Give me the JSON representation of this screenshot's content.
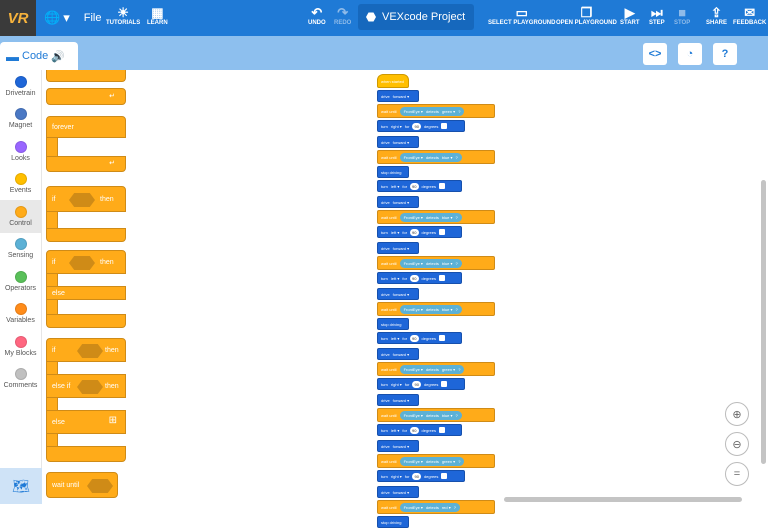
{
  "topbar": {
    "logo": "VR",
    "file": "File",
    "tutorials": "TUTORIALS",
    "learn": "LEARN",
    "undo": "UNDO",
    "redo": "REDO",
    "project": "VEXcode Project",
    "select_playground": "SELECT PLAYGROUND",
    "open_playground": "OPEN PLAYGROUND",
    "start": "START",
    "step": "STEP",
    "stop": "STOP",
    "share": "SHARE",
    "feedback": "FEEDBACK"
  },
  "code_tab": "Code",
  "categories": [
    {
      "label": "Drivetrain",
      "color": "#1e66d8"
    },
    {
      "label": "Magnet",
      "color": "#4a78c4"
    },
    {
      "label": "Looks",
      "color": "#9966ff"
    },
    {
      "label": "Events",
      "color": "#ffbf00"
    },
    {
      "label": "Control",
      "color": "#ffab19"
    },
    {
      "label": "Sensing",
      "color": "#5cb1d6"
    },
    {
      "label": "Operators",
      "color": "#59c059"
    },
    {
      "label": "Variables",
      "color": "#ff8c1a"
    },
    {
      "label": "My Blocks",
      "color": "#ff6680"
    },
    {
      "label": "Comments",
      "color": "#c0c0c0"
    }
  ],
  "palette": {
    "forever": "forever",
    "if": "if",
    "then": "then",
    "else": "else",
    "else_if": "else if",
    "wait_until": "wait until"
  },
  "script": [
    {
      "type": "hat",
      "text": "when started"
    },
    {
      "type": "drive",
      "text": "drive",
      "dir": "forward"
    },
    {
      "type": "wait",
      "sensor": "FrontEye",
      "color": "green"
    },
    {
      "type": "turn",
      "dir": "right",
      "deg": "90"
    },
    {
      "type": "drive",
      "text": "drive",
      "dir": "forward"
    },
    {
      "type": "wait",
      "sensor": "FrontEye",
      "color": "blue"
    },
    {
      "type": "stop",
      "text": "stop driving"
    },
    {
      "type": "turn",
      "dir": "left",
      "deg": "90"
    },
    {
      "type": "drive",
      "text": "drive",
      "dir": "forward"
    },
    {
      "type": "wait",
      "sensor": "FrontEye",
      "color": "blue"
    },
    {
      "type": "turn",
      "dir": "left",
      "deg": "90"
    },
    {
      "type": "drive",
      "text": "drive",
      "dir": "forward"
    },
    {
      "type": "wait",
      "sensor": "FrontEye",
      "color": "blue"
    },
    {
      "type": "turn",
      "dir": "left",
      "deg": "90"
    },
    {
      "type": "drive",
      "text": "drive",
      "dir": "forward"
    },
    {
      "type": "wait",
      "sensor": "FrontEye",
      "color": "blue"
    },
    {
      "type": "stop",
      "text": "stop driving"
    },
    {
      "type": "turn",
      "dir": "left",
      "deg": "90"
    },
    {
      "type": "drive",
      "text": "drive",
      "dir": "forward"
    },
    {
      "type": "wait",
      "sensor": "FrontEye",
      "color": "green"
    },
    {
      "type": "turn",
      "dir": "right",
      "deg": "90"
    },
    {
      "type": "drive",
      "text": "drive",
      "dir": "forward"
    },
    {
      "type": "wait",
      "sensor": "FrontEye",
      "color": "blue"
    },
    {
      "type": "turn",
      "dir": "left",
      "deg": "90"
    },
    {
      "type": "drive",
      "text": "drive",
      "dir": "forward"
    },
    {
      "type": "wait",
      "sensor": "FrontEye",
      "color": "green"
    },
    {
      "type": "turn",
      "dir": "right",
      "deg": "90"
    },
    {
      "type": "drive",
      "text": "drive",
      "dir": "forward"
    },
    {
      "type": "wait",
      "sensor": "FrontEye",
      "color": "red"
    },
    {
      "type": "stop",
      "text": "stop driving"
    }
  ],
  "labels": {
    "wait_until": "wait until",
    "detects": "detects",
    "turn": "turn",
    "for": "for",
    "degrees": "degrees"
  }
}
